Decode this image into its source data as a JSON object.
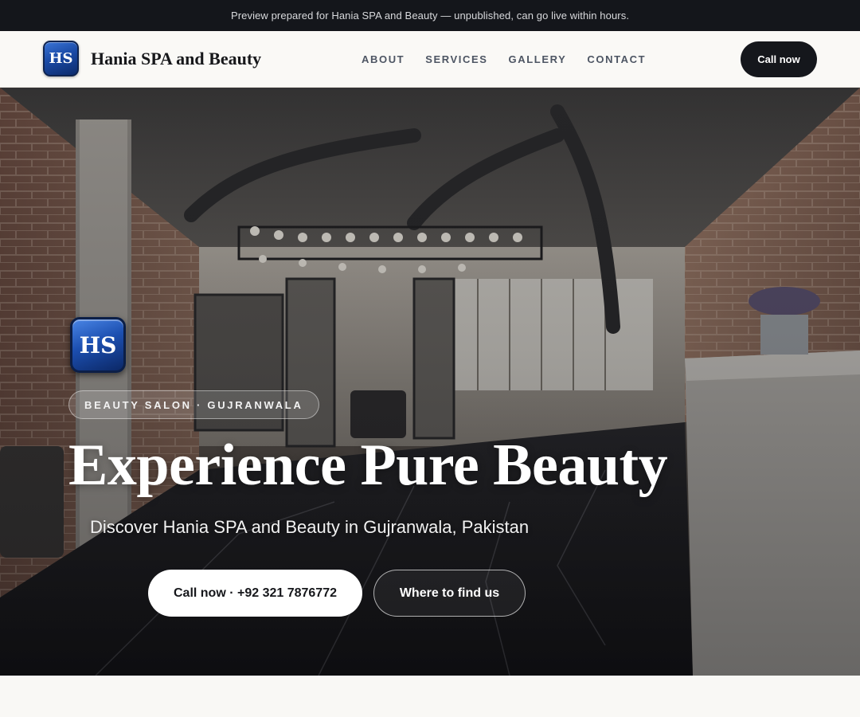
{
  "preview_banner": {
    "text": "Preview prepared for Hania SPA and Beauty — unpublished, can go live within hours."
  },
  "header": {
    "logo_text": "HS",
    "brand_name": "Hania SPA and Beauty",
    "nav": [
      {
        "label": "ABOUT"
      },
      {
        "label": "SERVICES"
      },
      {
        "label": "GALLERY"
      },
      {
        "label": "CONTACT"
      }
    ],
    "call_button": "Call now"
  },
  "hero": {
    "logo_text": "HS",
    "tagline_pill": "BEAUTY SALON · GUJRANWALA",
    "title": "Experience Pure Beauty",
    "subtitle": "Discover Hania SPA and Beauty in Gujranwala, Pakistan",
    "primary_cta": "Call now · +92 321 7876772",
    "secondary_cta": "Where to find us",
    "background_description_icon": "salon-interior-photo"
  },
  "colors": {
    "banner_bg": "#14161b",
    "header_bg": "#faf9f6",
    "dark_button": "#15171c",
    "logo_blue": "#1a4aa6",
    "nav_text": "#4d5563"
  }
}
